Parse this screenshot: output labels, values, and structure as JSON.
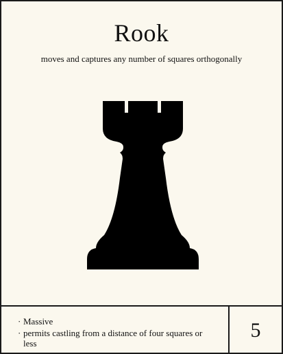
{
  "card": {
    "title": "Rook",
    "movement": "moves and captures any number of squares orthogonally",
    "piece_icon": "rook-icon",
    "traits": [
      "Massive",
      "permits castling from a distance of four squares or less"
    ],
    "value": "5"
  },
  "colors": {
    "background": "#fbf8ee",
    "ink": "#111111",
    "border": "#1a1a1a"
  }
}
